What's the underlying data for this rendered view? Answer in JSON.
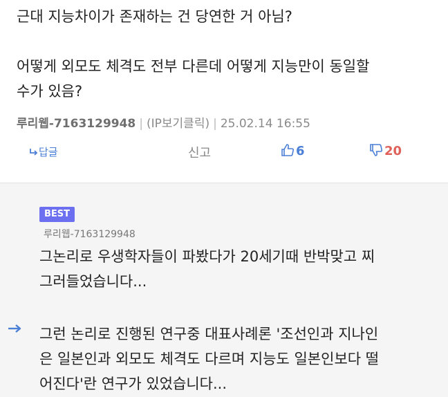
{
  "post": {
    "line1": "근대 지능차이가 존재하는 건 당연한 거 아님?",
    "line2": "어떻게 외모도 체격도 전부 다른데 어떻게 지능만이 동일할",
    "line3": "수가 있음?",
    "author": "루리웹-7163129948",
    "ip_link": "(IP보기클릭)",
    "timestamp": "25.02.14 16:55",
    "meta_separator": "|"
  },
  "actions": {
    "reply_label": "답글",
    "report_label": "신고",
    "upvotes": "6",
    "downvotes": "20"
  },
  "reply": {
    "badge": "BEST",
    "author": "루리웹-7163129948",
    "line1": "그논리로 우생학자들이 파봤다가 20세기때 반박맞고 찌",
    "line2": "그러들었습니다...",
    "line3": "그런 논리로 진행된 연구중 대표사례론 '조선인과 지나인",
    "line4": "은 일본인과 외모도 체격도 다르며 지능도 일본인보다 떨",
    "line5": "어진다'란 연구가 있었습니다..."
  },
  "colors": {
    "accent_blue": "#4a7fd6",
    "downvote_red": "#e0605a",
    "best_badge": "#6c6ff0",
    "reply_bg": "#f5f5f5"
  },
  "icons": {
    "reply": "reply-arrow-icon",
    "upvote": "thumbs-up-icon",
    "downvote": "thumbs-down-icon",
    "nested_reply": "nested-reply-arrow-icon"
  }
}
